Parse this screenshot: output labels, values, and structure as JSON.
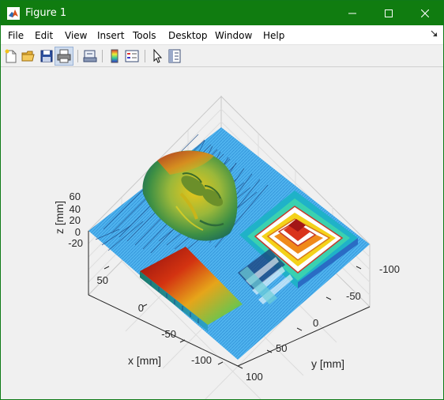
{
  "window": {
    "title": "Figure 1",
    "titlebar_color": "#107C10"
  },
  "menu": {
    "items": [
      "File",
      "Edit",
      "View",
      "Insert",
      "Tools",
      "Desktop",
      "Window",
      "Help"
    ]
  },
  "toolbar": {
    "buttons": [
      "new-figure-icon",
      "open-file-icon",
      "save-icon",
      "print-icon",
      "link-plot-icon",
      "insert-colorbar-icon",
      "insert-legend-icon",
      "edit-plot-icon",
      "property-inspector-icon"
    ]
  },
  "plot": {
    "xlabel": "x [mm]",
    "ylabel": "y [mm]",
    "zlabel": "z [mm]",
    "x_ticks": [
      "50",
      "0",
      "-50",
      "-100"
    ],
    "y_ticks": [
      "-100",
      "-50",
      "0",
      "50",
      "100"
    ],
    "z_ticks": [
      "60",
      "40",
      "20",
      "0",
      "-20"
    ],
    "colormap": "jet"
  }
}
